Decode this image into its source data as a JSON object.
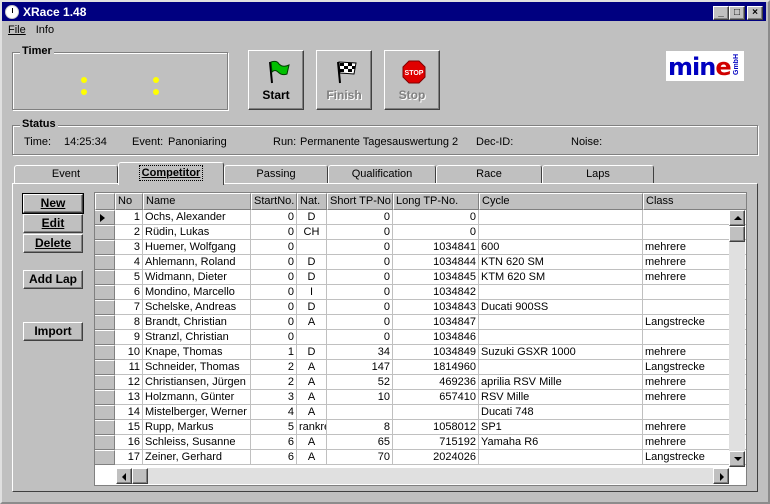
{
  "window": {
    "title": "XRace 1.48"
  },
  "menu": {
    "file": "File",
    "info": "Info"
  },
  "timer": {
    "label": "Timer"
  },
  "buttons": {
    "start": "Start",
    "finish": "Finish",
    "stop": "Stop"
  },
  "logo": {
    "main": "mine",
    "sub": "GmbH"
  },
  "status": {
    "label": "Status",
    "time_label": "Time:",
    "time_value": "14:25:34",
    "event_label": "Event:",
    "event_value": "Panoniaring",
    "run_label": "Run:",
    "run_value": "Permanente Tagesauswertung 2",
    "dec_label": "Dec-ID:",
    "noise_label": "Noise:"
  },
  "tabs": [
    "Event",
    "Competitor",
    "Passing",
    "Qualification",
    "Race",
    "Laps"
  ],
  "actions": {
    "new": "New",
    "edit": "Edit",
    "delete": "Delete",
    "add_lap": "Add Lap",
    "import": "Import"
  },
  "columns": [
    "No",
    "Name",
    "StartNo.",
    "Nat.",
    "Short TP-No.",
    "Long TP-No.",
    "Cycle",
    "Class"
  ],
  "rows": [
    [
      "1",
      "Ochs, Alexander",
      "0",
      "D",
      "0",
      "0",
      "",
      ""
    ],
    [
      "2",
      "Rüdin, Lukas",
      "0",
      "CH",
      "0",
      "0",
      "",
      ""
    ],
    [
      "3",
      "Huemer, Wolfgang",
      "0",
      "",
      "0",
      "1034841",
      "600",
      "mehrere"
    ],
    [
      "4",
      "Ahlemann, Roland",
      "0",
      "D",
      "0",
      "1034844",
      "KTN 620 SM",
      "mehrere"
    ],
    [
      "5",
      "Widmann, Dieter",
      "0",
      "D",
      "0",
      "1034845",
      "KTM 620 SM",
      "mehrere"
    ],
    [
      "6",
      "Mondino, Marcello",
      "0",
      "I",
      "0",
      "1034842",
      "",
      ""
    ],
    [
      "7",
      "Schelske, Andreas",
      "0",
      "D",
      "0",
      "1034843",
      "Ducati 900SS",
      ""
    ],
    [
      "8",
      "Brandt, Christian",
      "0",
      "A",
      "0",
      "1034847",
      "",
      "Langstrecke"
    ],
    [
      "9",
      "Stranzl, Christian",
      "0",
      "",
      "0",
      "1034846",
      "",
      ""
    ],
    [
      "10",
      "Knape, Thomas",
      "1",
      "D",
      "34",
      "1034849",
      "Suzuki GSXR 1000",
      "mehrere"
    ],
    [
      "11",
      "Schneider, Thomas",
      "2",
      "A",
      "147",
      "1814960",
      "",
      "Langstrecke"
    ],
    [
      "12",
      "Christiansen, Jürgen",
      "2",
      "A",
      "52",
      "469236",
      "aprilia RSV Mille",
      "mehrere"
    ],
    [
      "13",
      "Holzmann, Günter",
      "3",
      "A",
      "10",
      "657410",
      "RSV Mille",
      "mehrere"
    ],
    [
      "14",
      "Mistelberger, Werner",
      "4",
      "A",
      "",
      "",
      "Ducati 748",
      ""
    ],
    [
      "15",
      "Rupp, Markus",
      "5",
      "rankre",
      "8",
      "1058012",
      "SP1",
      "mehrere"
    ],
    [
      "16",
      "Schleiss, Susanne",
      "6",
      "A",
      "65",
      "715192",
      "Yamaha R6",
      "mehrere"
    ],
    [
      "17",
      "Zeiner, Gerhard",
      "6",
      "A",
      "70",
      "2024026",
      "",
      "Langstrecke"
    ]
  ]
}
